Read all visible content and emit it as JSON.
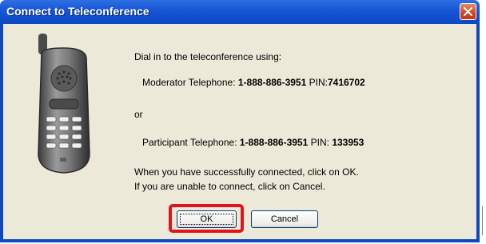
{
  "window": {
    "title": "Connect to Teleconference"
  },
  "body": {
    "intro": "Dial in to the teleconference using:",
    "moderator": {
      "label": "Moderator Telephone:",
      "number": "1-888-886-3951",
      "pin_label": "PIN:",
      "pin": "7416702"
    },
    "or_text": "or",
    "participant": {
      "label": "Participant Telephone:",
      "number": "1-888-886-3951",
      "pin_label": "PIN:",
      "pin": "133953"
    },
    "instruction_ok": "When you have successfully connected, click on OK.",
    "instruction_cancel": "If you are unable to connect, click on Cancel."
  },
  "buttons": {
    "ok": "OK",
    "cancel": "Cancel"
  },
  "icons": {
    "close": "close-icon",
    "phone": "mobile-phone-icon"
  },
  "colors": {
    "titlebar": "#0c48c0",
    "highlight": "#e0141e",
    "dialog_bg": "#ece9d8"
  }
}
